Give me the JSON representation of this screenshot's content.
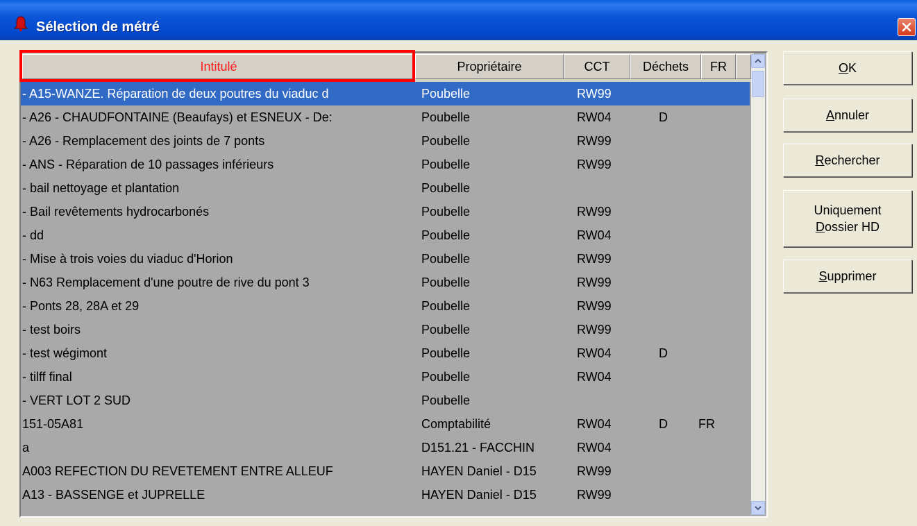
{
  "window": {
    "title": "Sélection de métré"
  },
  "columns": {
    "intitule": "Intitulé",
    "proprietaire": "Propriétaire",
    "cct": "CCT",
    "dechets": "Déchets",
    "fr": "FR"
  },
  "rows": [
    {
      "intitule": "- A15-WANZE. Réparation de deux poutres du viaduc d",
      "proprietaire": "Poubelle",
      "cct": "RW99",
      "dechets": "",
      "fr": ""
    },
    {
      "intitule": "- A26 - CHAUDFONTAINE (Beaufays) et ESNEUX - De:",
      "proprietaire": "Poubelle",
      "cct": "RW04",
      "dechets": "D",
      "fr": ""
    },
    {
      "intitule": "- A26 - Remplacement des joints de 7 ponts",
      "proprietaire": "Poubelle",
      "cct": "RW99",
      "dechets": "",
      "fr": ""
    },
    {
      "intitule": "- ANS - Réparation de 10 passages inférieurs",
      "proprietaire": "Poubelle",
      "cct": "RW99",
      "dechets": "",
      "fr": ""
    },
    {
      "intitule": "- bail nettoyage et plantation",
      "proprietaire": "Poubelle",
      "cct": "",
      "dechets": "",
      "fr": ""
    },
    {
      "intitule": "- Bail revêtements hydrocarbonés",
      "proprietaire": "Poubelle",
      "cct": "RW99",
      "dechets": "",
      "fr": ""
    },
    {
      "intitule": "- dd",
      "proprietaire": "Poubelle",
      "cct": "RW04",
      "dechets": "",
      "fr": ""
    },
    {
      "intitule": "- Mise à trois voies du viaduc d'Horion",
      "proprietaire": "Poubelle",
      "cct": "RW99",
      "dechets": "",
      "fr": ""
    },
    {
      "intitule": "- N63 Remplacement d'une poutre de rive du pont 3",
      "proprietaire": "Poubelle",
      "cct": "RW99",
      "dechets": "",
      "fr": ""
    },
    {
      "intitule": "- Ponts 28, 28A et 29",
      "proprietaire": "Poubelle",
      "cct": "RW99",
      "dechets": "",
      "fr": ""
    },
    {
      "intitule": "- test boirs",
      "proprietaire": "Poubelle",
      "cct": "RW99",
      "dechets": "",
      "fr": ""
    },
    {
      "intitule": "- test wégimont",
      "proprietaire": "Poubelle",
      "cct": "RW04",
      "dechets": "D",
      "fr": ""
    },
    {
      "intitule": "- tilff final",
      "proprietaire": "Poubelle",
      "cct": "RW04",
      "dechets": "",
      "fr": ""
    },
    {
      "intitule": "- VERT  LOT 2 SUD",
      "proprietaire": "Poubelle",
      "cct": "",
      "dechets": "",
      "fr": ""
    },
    {
      "intitule": "151-05A81",
      "proprietaire": "Comptabilité",
      "cct": "RW04",
      "dechets": "D",
      "fr": "FR"
    },
    {
      "intitule": "a",
      "proprietaire": "D151.21 - FACCHIN",
      "cct": "RW04",
      "dechets": "",
      "fr": ""
    },
    {
      "intitule": "A003 REFECTION DU REVETEMENT ENTRE ALLEUF",
      "proprietaire": "HAYEN Daniel - D15",
      "cct": "RW99",
      "dechets": "",
      "fr": ""
    },
    {
      "intitule": "A13 - BASSENGE et JUPRELLE",
      "proprietaire": "HAYEN Daniel - D15",
      "cct": "RW99",
      "dechets": "",
      "fr": ""
    }
  ],
  "buttons": {
    "ok": {
      "mnemonic": "O",
      "rest": "K"
    },
    "annuler": {
      "mnemonic": "A",
      "rest": "nnuler"
    },
    "rechercher": {
      "mnemonic": "R",
      "rest": "echercher"
    },
    "uniquement": {
      "line1": "Uniquement",
      "mnemonic": "D",
      "rest": "ossier HD"
    },
    "supprimer": {
      "mnemonic": "S",
      "rest": "upprimer"
    }
  },
  "colors": {
    "selection": "#316ac5",
    "active_header_text": "#ff1a1a",
    "highlight_box": "#ff0000",
    "grid_background": "#a9a9a9"
  }
}
